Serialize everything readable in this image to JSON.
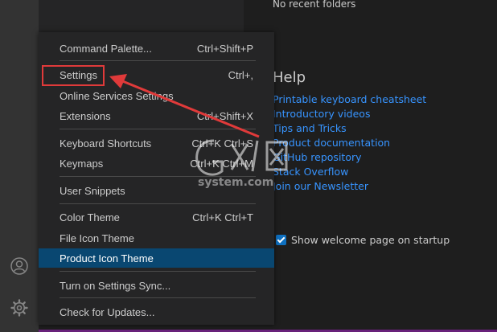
{
  "welcome": {
    "recent_empty": "No recent folders",
    "help_title": "Help",
    "help_links": [
      "Printable keyboard cheatsheet",
      "Introductory videos",
      "Tips and Tricks",
      "Product documentation",
      "GitHub repository",
      "Stack Overflow",
      "Join our Newsletter"
    ],
    "show_on_startup": "Show welcome page on startup",
    "show_on_startup_checked": true
  },
  "menu": {
    "items": [
      {
        "label": "Command Palette...",
        "shortcut": "Ctrl+Shift+P"
      },
      {
        "label": "Settings",
        "shortcut": "Ctrl+,"
      },
      {
        "label": "Online Services Settings",
        "shortcut": ""
      },
      {
        "label": "Extensions",
        "shortcut": "Ctrl+Shift+X"
      },
      {
        "label": "Keyboard Shortcuts",
        "shortcut": "Ctrl+K Ctrl+S"
      },
      {
        "label": "Keymaps",
        "shortcut": "Ctrl+K Ctrl+M"
      },
      {
        "label": "User Snippets",
        "shortcut": ""
      },
      {
        "label": "Color Theme",
        "shortcut": "Ctrl+K Ctrl+T"
      },
      {
        "label": "File Icon Theme",
        "shortcut": ""
      },
      {
        "label": "Product Icon Theme",
        "shortcut": ""
      },
      {
        "label": "Turn on Settings Sync...",
        "shortcut": ""
      },
      {
        "label": "Check for Updates...",
        "shortcut": ""
      }
    ]
  },
  "activity_bar": {
    "icons": [
      "account-icon",
      "manage-gear-icon"
    ]
  },
  "watermark": {
    "logo_text": "GX/网",
    "sub_text": "system.com"
  },
  "colors": {
    "accent": "#094771",
    "link": "#3794ff",
    "annotation": "#e03a3a"
  }
}
